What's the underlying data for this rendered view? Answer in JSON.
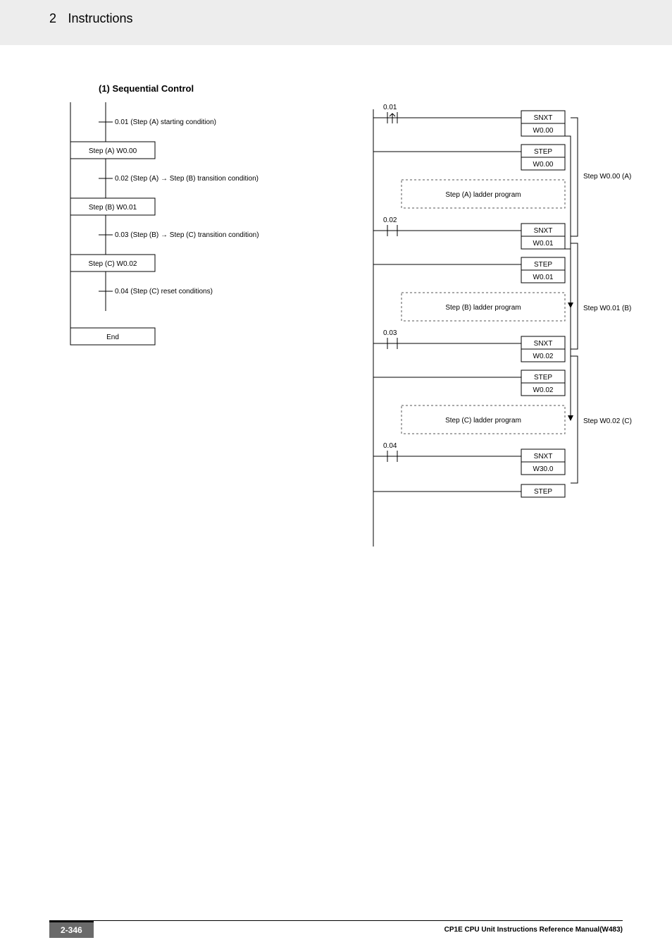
{
  "header": {
    "chapter_number": "2",
    "chapter_title": "Instructions"
  },
  "subheading": "(1)  Sequential Control",
  "flowchart": {
    "cond_a_start": "0.01 (Step (A) starting condition)",
    "step_a": "Step (A) W0.00",
    "cond_ab": "0.02 (Step (A) → Step (B) transition condition)",
    "step_b": "Step (B) W0.01",
    "cond_bc": "0.03 (Step (B) → Step (C) transition condition)",
    "step_c": "Step (C) W0.02",
    "cond_c_reset": "0.04 (Step (C) reset conditions)",
    "end": "End"
  },
  "ladder": {
    "rung1": {
      "addr": "0.01",
      "inst": "SNXT",
      "op": "W0.00"
    },
    "stepA": {
      "inst": "STEP",
      "op": "W0.00",
      "prog": "Step (A) ladder program",
      "label": "Step W0.00 (A)"
    },
    "rung2": {
      "addr": "0.02",
      "inst": "SNXT",
      "op": "W0.01"
    },
    "stepB": {
      "inst": "STEP",
      "op": "W0.01",
      "prog": "Step (B) ladder program",
      "label": "Step W0.01 (B)"
    },
    "rung3": {
      "addr": "0.03",
      "inst": "SNXT",
      "op": "W0.02"
    },
    "stepC": {
      "inst": "STEP",
      "op": "W0.02",
      "prog": "Step (C) ladder program",
      "label": "Step W0.02 (C)"
    },
    "rung4": {
      "addr": "0.04",
      "inst": "SNXT",
      "op": "W30.0"
    },
    "final": {
      "inst": "STEP"
    }
  },
  "footer": {
    "page": "2-346",
    "manual": "CP1E CPU Unit Instructions Reference Manual(W483)"
  }
}
